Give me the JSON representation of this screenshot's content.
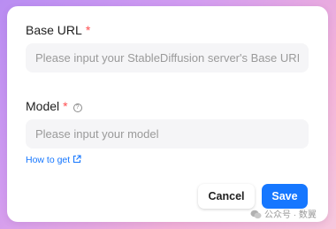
{
  "form": {
    "base_url": {
      "label": "Base URL",
      "required_mark": "*",
      "value": "",
      "placeholder": "Please input your StableDiffusion server's Base URI"
    },
    "model": {
      "label": "Model",
      "required_mark": "*",
      "help_icon": "question-circle-icon",
      "value": "",
      "placeholder": "Please input your model"
    },
    "help_link": {
      "label": "How to get",
      "icon": "external-link-icon"
    }
  },
  "actions": {
    "cancel_label": "Cancel",
    "save_label": "Save"
  },
  "watermark": {
    "text": "公众号 · 数翼",
    "icon": "wechat-icon"
  },
  "colors": {
    "primary": "#1677ff",
    "required": "#ff4d4f",
    "input_bg": "#f5f5f7",
    "background_gradient_start": "#b98df2",
    "background_gradient_end": "#f6c6dc"
  }
}
